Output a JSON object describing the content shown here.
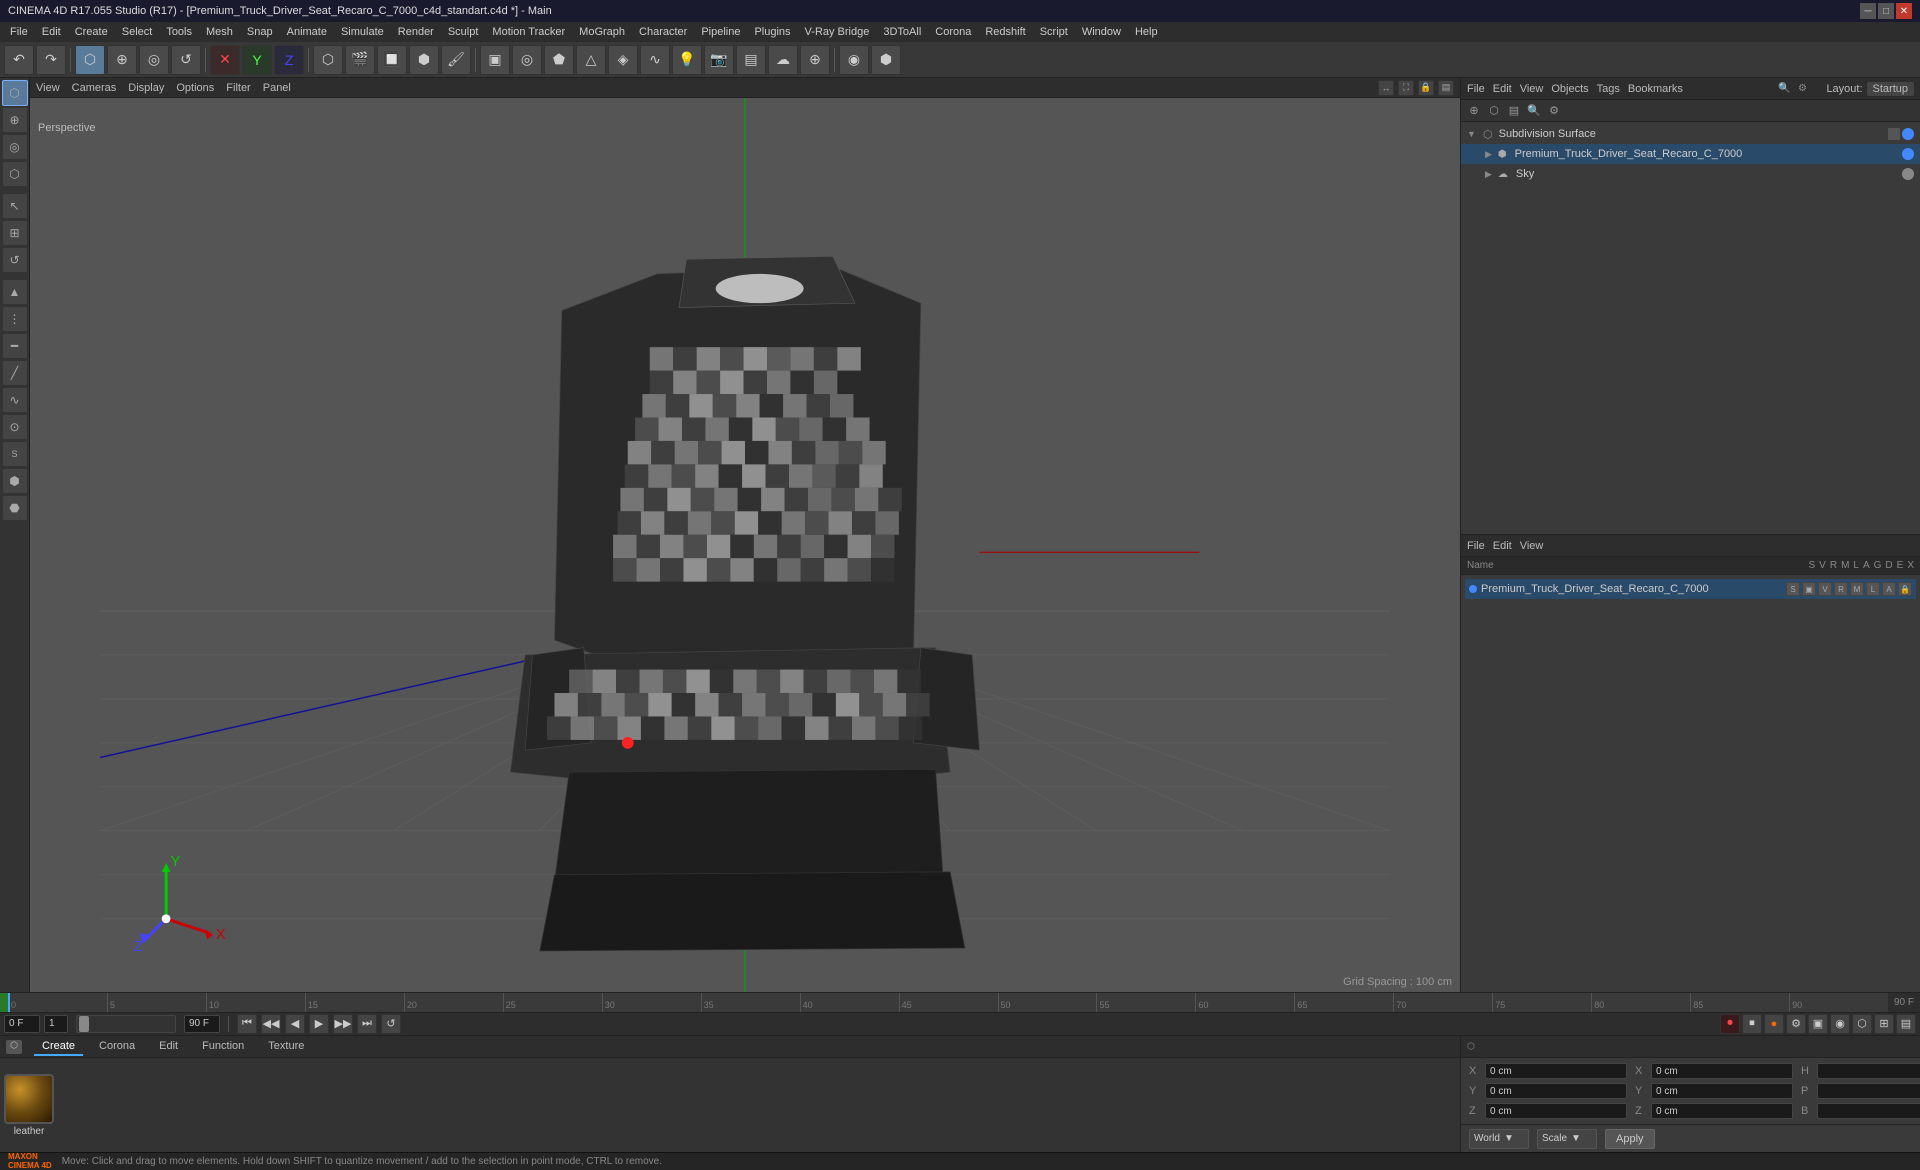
{
  "titlebar": {
    "title": "CINEMA 4D R17.055 Studio (R17) - [Premium_Truck_Driver_Seat_Recaro_C_7000_c4d_standart.c4d *] - Main",
    "min_label": "─",
    "max_label": "□",
    "close_label": "✕"
  },
  "menubar": {
    "items": [
      "File",
      "Edit",
      "Create",
      "Select",
      "Tools",
      "Mesh",
      "Snap",
      "Animate",
      "Simulate",
      "Render",
      "Sculpt",
      "Motion Tracker",
      "MoGraph",
      "Character",
      "Pipeline",
      "Plugins",
      "V-Ray Bridge",
      "3DToAll",
      "Corona",
      "Redshift",
      "Script",
      "Window",
      "Help"
    ]
  },
  "toolbar": {
    "buttons": [
      "↶",
      "↷",
      "⊕",
      "⊞",
      "◎",
      "⊕",
      "⊠",
      "X",
      "Y",
      "Z",
      "⬡",
      "🎬",
      "🎞",
      "🖌",
      "●",
      "↺",
      "▤",
      "◻",
      "⬢",
      "◈",
      "▲",
      "✦",
      "⚙",
      "🔨",
      "✏",
      "◉",
      "⬟",
      "∿",
      "💡"
    ]
  },
  "left_tools": {
    "buttons": [
      "↖",
      "⊕",
      "◎",
      "⬡",
      "▲",
      "◆",
      "⬟",
      "▤",
      "━",
      "∿",
      "⊙",
      "S",
      "↺",
      "⬢",
      "⬣",
      "●",
      "◈"
    ]
  },
  "viewport": {
    "header_items": [
      "View",
      "Cameras",
      "Display",
      "Options",
      "Filter",
      "Panel"
    ],
    "label": "Perspective",
    "grid_spacing": "Grid Spacing : 100 cm",
    "corner_btns": [
      "↔",
      "⛶",
      "⊡",
      "▤"
    ]
  },
  "scene_panel": {
    "header_items": [
      "File",
      "Edit",
      "View",
      "Objects",
      "Tags",
      "Bookmarks"
    ],
    "layout_label": "Layout:",
    "layout_value": "Startup",
    "items": [
      {
        "name": "Subdivision Surface",
        "type": "subdivision",
        "expanded": true,
        "children": [
          {
            "name": "Premium_Truck_Driver_Seat_Recaro_C_7000",
            "type": "mesh",
            "dot_color": "blue"
          },
          {
            "name": "Sky",
            "type": "sky",
            "dot_color": "gray"
          }
        ]
      }
    ]
  },
  "attributes_panel": {
    "header_items": [
      "File",
      "Edit",
      "View"
    ],
    "col_headers": [
      "Name",
      "S",
      "V",
      "R",
      "M",
      "L",
      "A",
      "G",
      "D",
      "E",
      "X"
    ],
    "items": [
      {
        "name": "Premium_Truck_Driver_Seat_Recaro_C_7000",
        "dot_color": "blue"
      }
    ]
  },
  "timeline": {
    "marks": [
      "0",
      "5",
      "10",
      "15",
      "20",
      "25",
      "30",
      "35",
      "40",
      "45",
      "50",
      "55",
      "60",
      "65",
      "70",
      "75",
      "80",
      "85",
      "90"
    ],
    "end_frame": "90 F",
    "frame_indicator": "0 F"
  },
  "playback": {
    "current_frame": "0 F",
    "frame_step": "1",
    "min_frame": "0",
    "max_frame": "90 F",
    "end_display": "0 F",
    "buttons": {
      "to_start": "⏮",
      "prev_key": "⏪",
      "play_back": "◀",
      "play": "▶",
      "play_fwd": "▶▶",
      "next_key": "⏩",
      "to_end": "⏭",
      "loop": "🔁"
    },
    "right_buttons": [
      "🎯",
      "⏹",
      "🔴",
      "⚙",
      "▣",
      "◉",
      "⬡",
      "⊞",
      "▤"
    ]
  },
  "bottom_tabs": {
    "tabs": [
      "Create",
      "Corona",
      "Edit",
      "Function",
      "Texture"
    ]
  },
  "material": {
    "name": "leather",
    "color_top": "#8B6914",
    "color_bottom": "#5a4010"
  },
  "transform": {
    "x_pos": "0 cm",
    "y_pos": "0 cm",
    "z_pos": "0 cm",
    "x_rot": "0 cm",
    "y_rot": "0 cm",
    "z_rot": "0 cm",
    "h_val": "",
    "p_val": "",
    "b_val": "",
    "coord_system": "World",
    "scale_label": "Scale",
    "apply_label": "Apply"
  },
  "status_bar": {
    "logo": "MAXON\nCINEMA 4D",
    "message": "Move: Click and drag to move elements. Hold down SHIFT to quantize movement / add to the selection in point mode, CTRL to remove."
  }
}
